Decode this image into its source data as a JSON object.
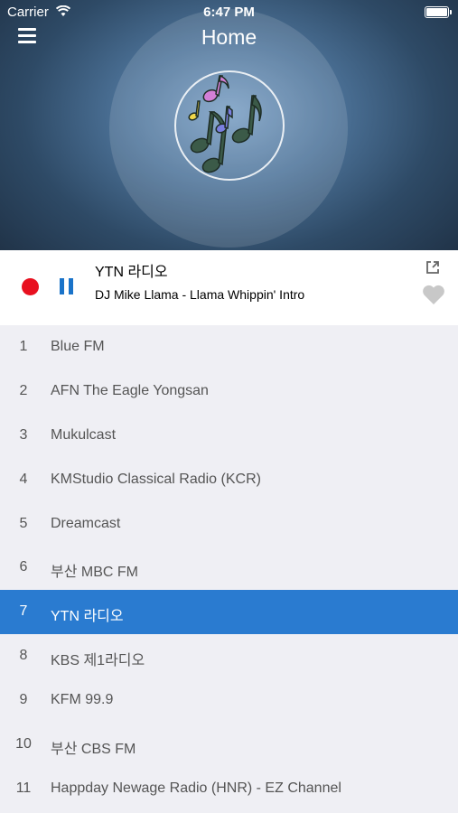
{
  "status_bar": {
    "carrier": "Carrier",
    "time": "6:47 PM"
  },
  "nav": {
    "title": "Home",
    "menu_icon": "hamburger-menu-icon"
  },
  "artwork": {
    "icon": "music-notes-icon"
  },
  "now_playing": {
    "station": "YTN 라디오",
    "track": "DJ Mike Llama - Llama Whippin' Intro",
    "record_icon": "record-icon",
    "pause_icon": "pause-icon",
    "share_icon": "share-icon",
    "favorite_icon": "heart-icon"
  },
  "colors": {
    "accent": "#2a7bd0",
    "record": "#e8101f",
    "pause": "#1a73c9"
  },
  "stations": [
    {
      "num": "1",
      "name": "Blue FM"
    },
    {
      "num": "2",
      "name": "AFN The Eagle Yongsan"
    },
    {
      "num": "3",
      "name": "Mukulcast"
    },
    {
      "num": "4",
      "name": "KMStudio Classical Radio (KCR)"
    },
    {
      "num": "5",
      "name": "Dreamcast"
    },
    {
      "num": "6",
      "name": "부산 MBC FM"
    },
    {
      "num": "7",
      "name": "YTN 라디오",
      "selected": true
    },
    {
      "num": "8",
      "name": "KBS 제1라디오"
    },
    {
      "num": "9",
      "name": "KFM 99.9"
    },
    {
      "num": "10",
      "name": "부산 CBS FM"
    },
    {
      "num": "11",
      "name": "Happday Newage Radio (HNR) - EZ Channel"
    }
  ]
}
